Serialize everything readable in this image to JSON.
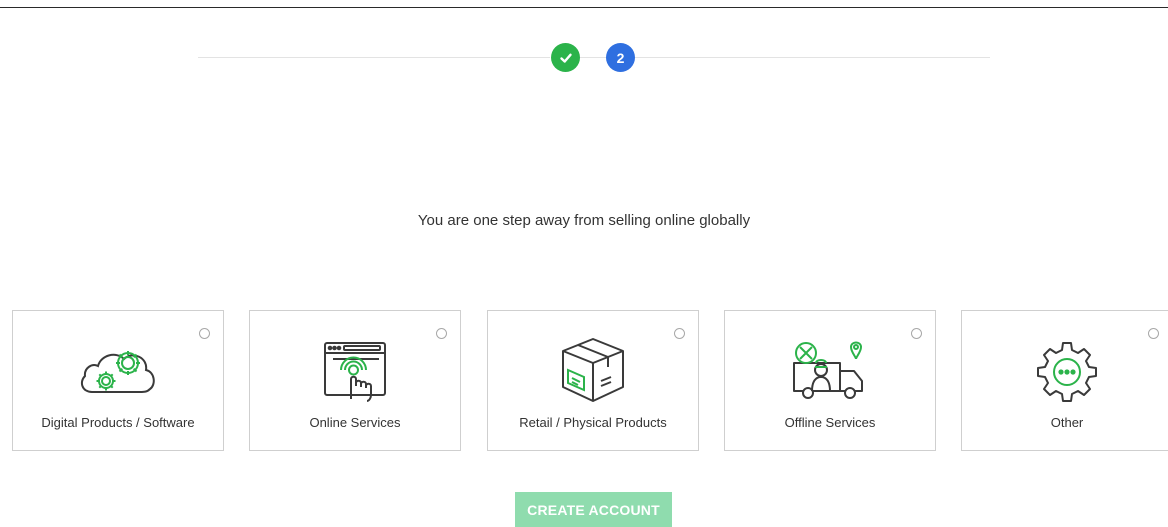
{
  "stepper": {
    "steps": [
      {
        "label": "",
        "state": "completed",
        "color": "#2bb34a"
      },
      {
        "label": "2",
        "state": "current",
        "color": "#2f6fe0"
      }
    ]
  },
  "main": {
    "tagline": "You are one step away from selling online globally"
  },
  "business_types": [
    {
      "label": "Digital Products / Software",
      "icon": "cloud-gears-icon",
      "selected": false
    },
    {
      "label": "Online Services",
      "icon": "browser-touch-icon",
      "selected": false
    },
    {
      "label": "Retail / Physical Products",
      "icon": "package-box-icon",
      "selected": false
    },
    {
      "label": "Offline Services",
      "icon": "delivery-truck-worker-icon",
      "selected": false
    },
    {
      "label": "Other",
      "icon": "gear-dots-icon",
      "selected": false
    }
  ],
  "actions": {
    "create_account_label": "CREATE ACCOUNT",
    "button_color": "#8fdcae"
  }
}
